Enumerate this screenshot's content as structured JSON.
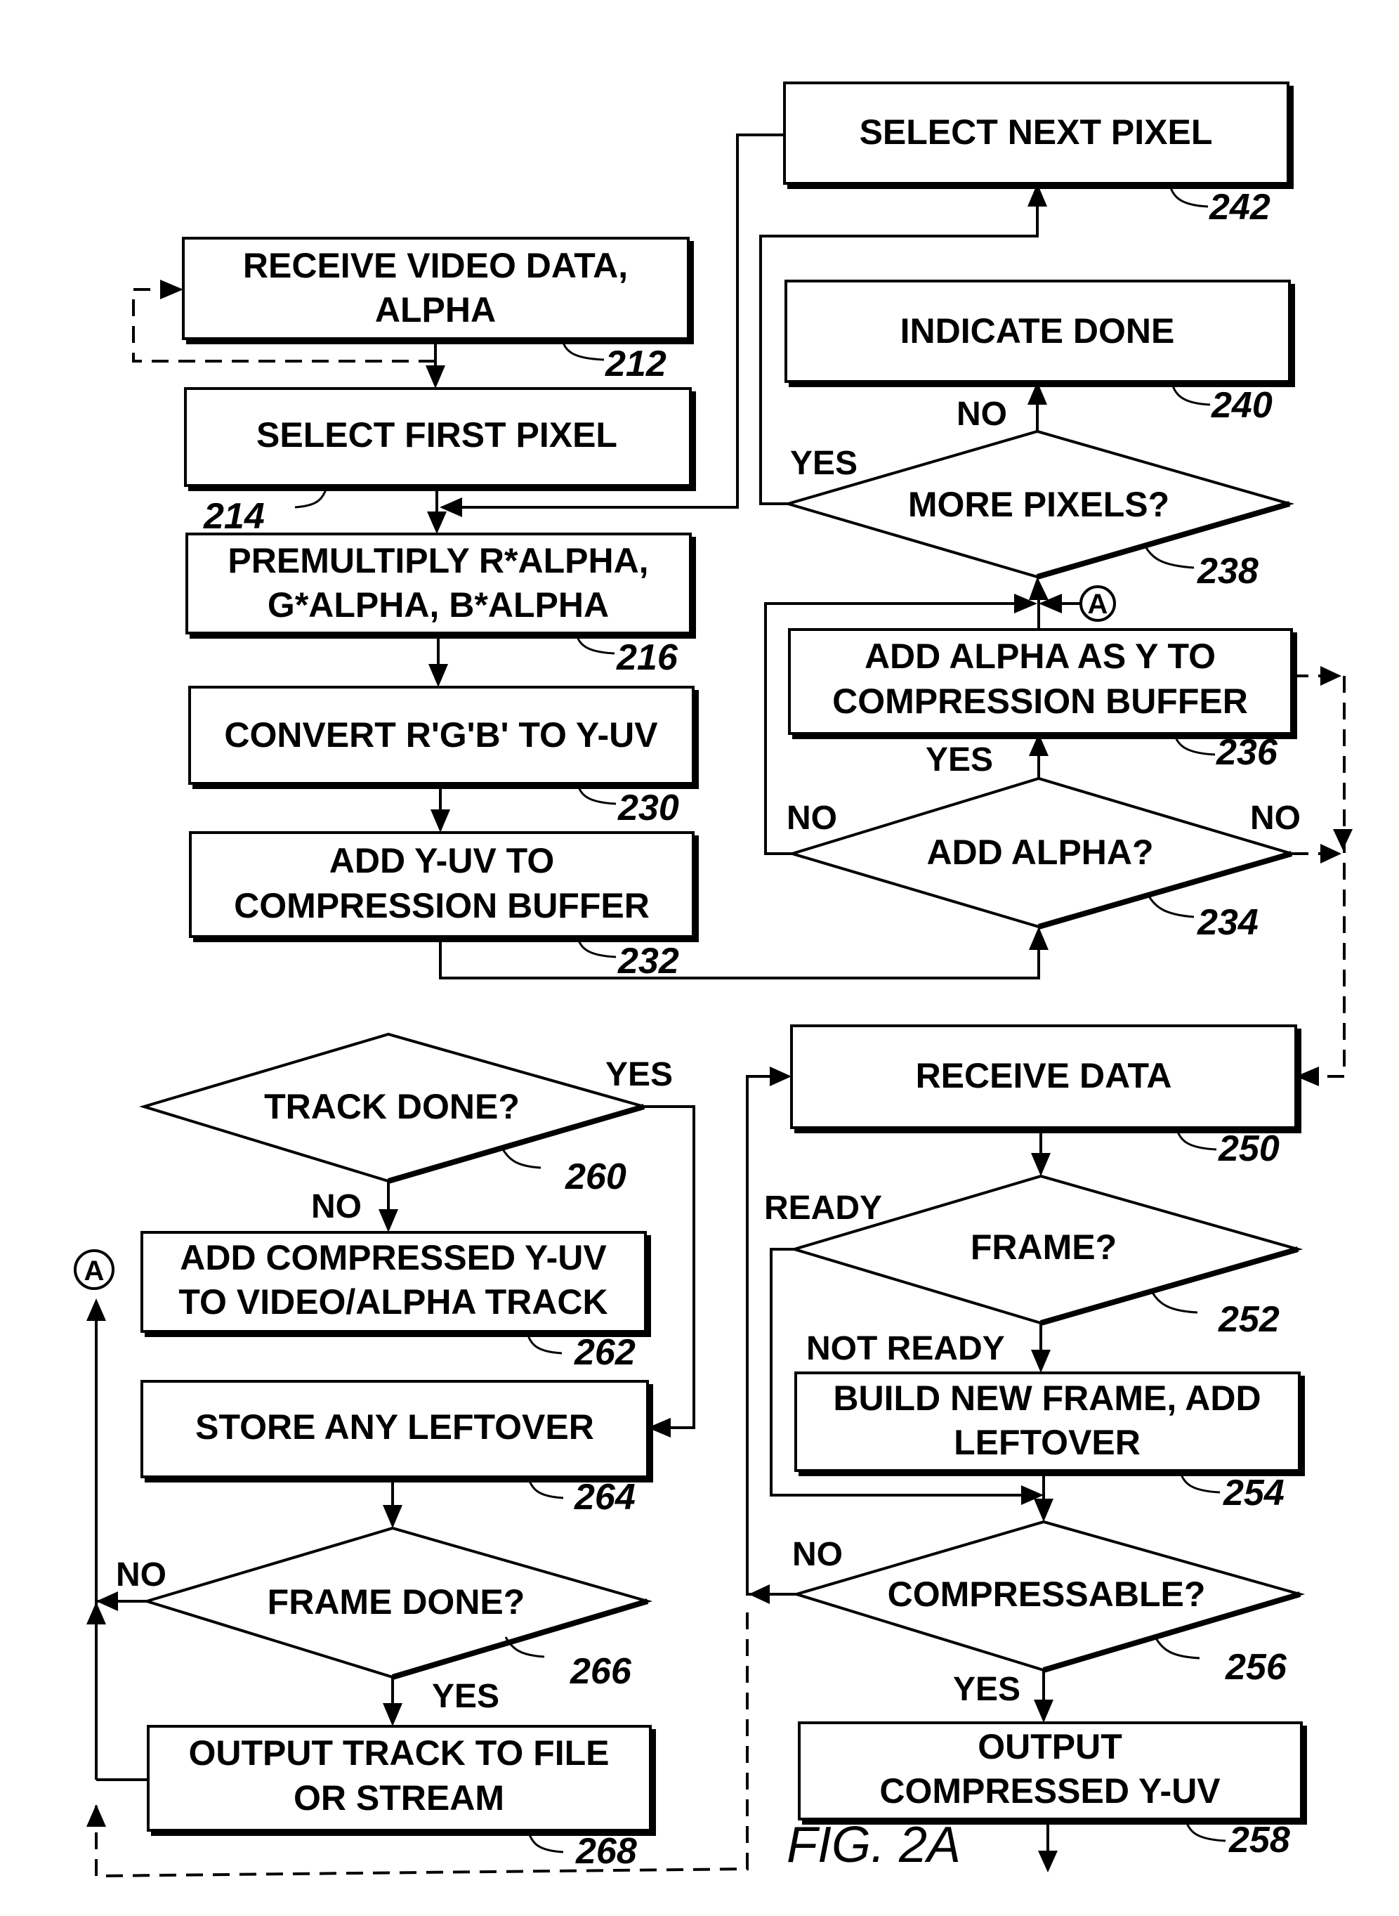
{
  "figure": {
    "label": "FIG. 2A",
    "connector_label": "A"
  },
  "nodes": {
    "n212": {
      "ref": "212",
      "type": "process",
      "lines": [
        "RECEIVE VIDEO DATA,",
        "ALPHA"
      ]
    },
    "n214": {
      "ref": "214",
      "type": "process",
      "lines": [
        "SELECT FIRST PIXEL"
      ]
    },
    "n216": {
      "ref": "216",
      "type": "process",
      "lines": [
        "PREMULTIPLY R*ALPHA,",
        "G*ALPHA, B*ALPHA"
      ]
    },
    "n230": {
      "ref": "230",
      "type": "process",
      "lines": [
        "CONVERT R'G'B' TO Y-UV"
      ]
    },
    "n232": {
      "ref": "232",
      "type": "process",
      "lines": [
        "ADD Y-UV TO",
        "COMPRESSION BUFFER"
      ]
    },
    "n234": {
      "ref": "234",
      "type": "decision",
      "lines": [
        "ADD ALPHA?"
      ]
    },
    "n236": {
      "ref": "236",
      "type": "process",
      "lines": [
        "ADD ALPHA AS Y TO",
        "COMPRESSION BUFFER"
      ]
    },
    "n238": {
      "ref": "238",
      "type": "decision",
      "lines": [
        "MORE PIXELS?"
      ]
    },
    "n240": {
      "ref": "240",
      "type": "process",
      "lines": [
        "INDICATE DONE"
      ]
    },
    "n242": {
      "ref": "242",
      "type": "process",
      "lines": [
        "SELECT NEXT PIXEL"
      ]
    },
    "n250": {
      "ref": "250",
      "type": "process",
      "lines": [
        "RECEIVE DATA"
      ]
    },
    "n252": {
      "ref": "252",
      "type": "decision",
      "lines": [
        "FRAME?"
      ]
    },
    "n254": {
      "ref": "254",
      "type": "process",
      "lines": [
        "BUILD NEW FRAME, ADD",
        "LEFTOVER"
      ]
    },
    "n256": {
      "ref": "256",
      "type": "decision",
      "lines": [
        "COMPRESSABLE?"
      ]
    },
    "n258": {
      "ref": "258",
      "type": "process",
      "lines": [
        "OUTPUT",
        "COMPRESSED Y-UV"
      ]
    },
    "n260": {
      "ref": "260",
      "type": "decision",
      "lines": [
        "TRACK DONE?"
      ]
    },
    "n262": {
      "ref": "262",
      "type": "process",
      "lines": [
        "ADD COMPRESSED Y-UV",
        "TO VIDEO/ALPHA TRACK"
      ]
    },
    "n264": {
      "ref": "264",
      "type": "process",
      "lines": [
        "STORE ANY LEFTOVER"
      ]
    },
    "n266": {
      "ref": "266",
      "type": "decision",
      "lines": [
        "FRAME DONE?"
      ]
    },
    "n268": {
      "ref": "268",
      "type": "process",
      "lines": [
        "OUTPUT TRACK TO FILE",
        "OR STREAM"
      ]
    }
  },
  "edge_labels": {
    "e238_no": "NO",
    "e238_yes": "YES",
    "e234_yes": "YES",
    "e234_no_left": "NO",
    "e234_no_right": "NO",
    "e252_ready": "READY",
    "e252_not_ready": "NOT READY",
    "e256_no": "NO",
    "e256_yes": "YES",
    "e260_yes": "YES",
    "e260_no": "NO",
    "e266_no": "NO",
    "e266_yes": "YES"
  }
}
